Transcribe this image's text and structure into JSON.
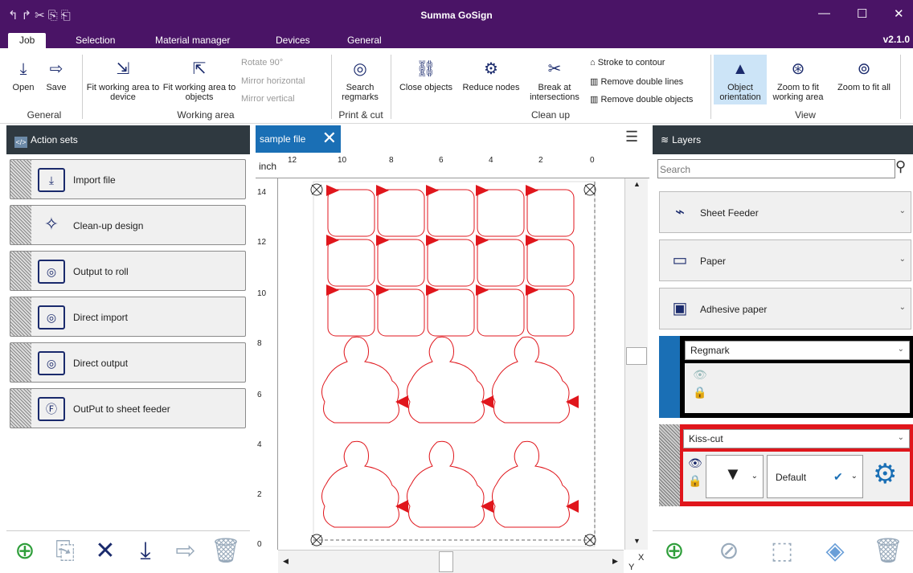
{
  "app": {
    "title": "Summa GoSign",
    "version": "v2.1.0",
    "quick_access": "↰↱✂⎘⎗"
  },
  "window_controls": {
    "minimize": "—",
    "maximize": "☐",
    "close": "✕"
  },
  "menu_tabs": [
    "Job",
    "Selection",
    "Material manager",
    "Devices",
    "General"
  ],
  "ribbon": {
    "open": "Open",
    "save": "Save",
    "group_general": "General",
    "fit_device": "Fit working area to device",
    "fit_objects": "Fit working area to objects",
    "rotate": "Rotate 90°",
    "mirror_h": "Mirror horizontal",
    "mirror_v": "Mirror vertical",
    "group_working_area": "Working area",
    "search_regmarks": "Search regmarks",
    "group_print_cut": "Print & cut",
    "close_objects": "Close objects",
    "reduce_nodes": "Reduce nodes",
    "break": "Break at intersections",
    "stroke": "Stroke to contour",
    "remove_lines": "Remove double lines",
    "remove_objects": "Remove double objects",
    "group_clean_up": "Clean up",
    "orientation": "Object orientation",
    "zoom_working": "Zoom to fit working area",
    "zoom_all": "Zoom to fit all",
    "group_view": "View"
  },
  "action_sets": {
    "title": "Action sets",
    "items": [
      "Import file",
      "Clean-up design",
      "Output to roll",
      "Direct import",
      "Direct output",
      "OutPut to sheet feeder"
    ]
  },
  "document": {
    "tab": "sample file",
    "unit": "inch",
    "ruler_top": [
      "12",
      "10",
      "8",
      "6",
      "4",
      "2",
      "0"
    ],
    "ruler_left": [
      "14",
      "12",
      "10",
      "8",
      "6",
      "4",
      "2",
      "0"
    ]
  },
  "layers": {
    "title": "Layers",
    "search_placeholder": "Search",
    "items": [
      "Sheet Feeder",
      "Paper",
      "Adhesive paper"
    ],
    "regmark": "Regmark",
    "kiss_cut": "Kiss-cut",
    "kiss_default": "Default"
  },
  "colors": {
    "titlebar": "#4a1466",
    "panel_header": "#2f3940",
    "accent": "#1a6fb5",
    "cut_line": "#e0161c"
  },
  "axis_labels": {
    "x": "X",
    "y": "Y"
  }
}
